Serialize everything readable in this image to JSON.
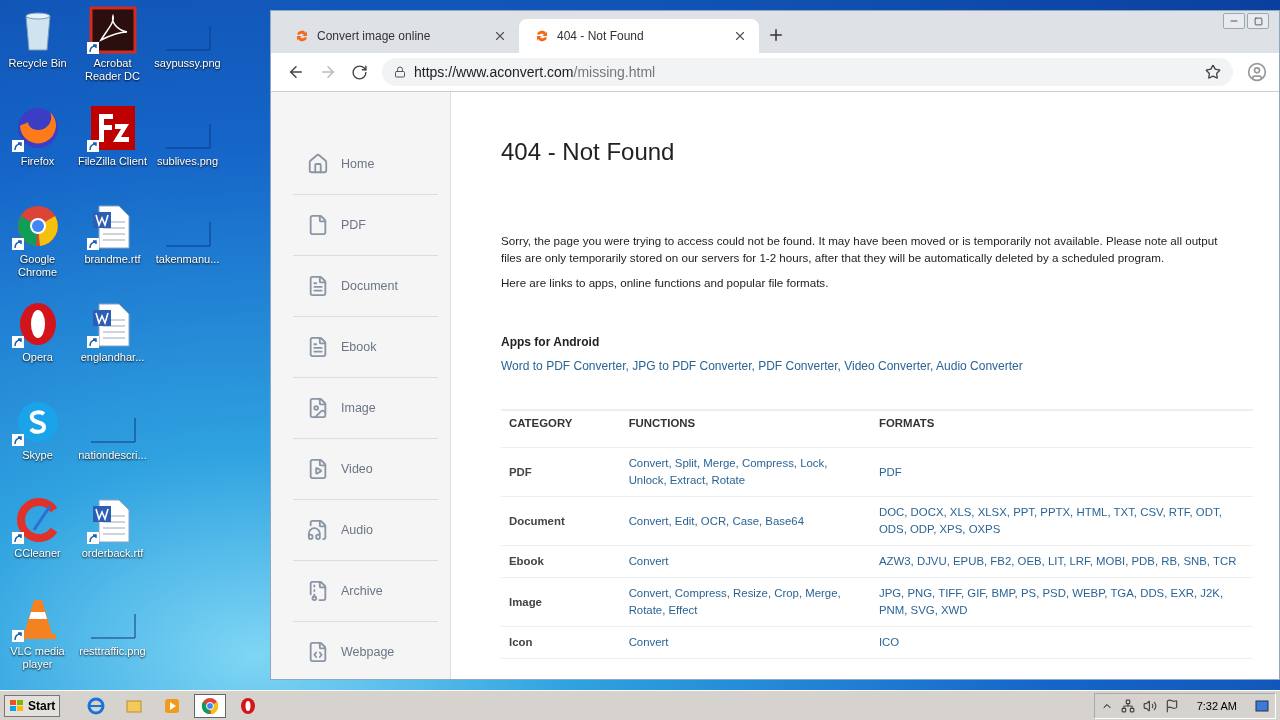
{
  "desktop": {
    "icons": [
      {
        "label": "Recycle Bin",
        "kind": "recycle"
      },
      {
        "label": "Firefox",
        "kind": "firefox"
      },
      {
        "label": "Google Chrome",
        "kind": "chrome"
      },
      {
        "label": "Opera",
        "kind": "opera"
      },
      {
        "label": "Skype",
        "kind": "skype"
      },
      {
        "label": "CCleaner",
        "kind": "ccleaner"
      },
      {
        "label": "VLC media player",
        "kind": "vlc"
      },
      {
        "label": "Acrobat Reader DC",
        "kind": "acrobat"
      },
      {
        "label": "FileZilla Client",
        "kind": "filezilla"
      },
      {
        "label": "brandme.rtf",
        "kind": "word"
      },
      {
        "label": "englandhar...",
        "kind": "word"
      },
      {
        "label": "nationdescri...",
        "kind": "blank"
      },
      {
        "label": "orderback.rtf",
        "kind": "word"
      },
      {
        "label": "resttraffic.png",
        "kind": "blank"
      },
      {
        "label": "saypussy.png",
        "kind": "blank"
      },
      {
        "label": "sublives.png",
        "kind": "blank"
      },
      {
        "label": "takenmanu...",
        "kind": "blank"
      }
    ]
  },
  "browser": {
    "tabs": [
      {
        "title": "Convert image online",
        "selected": false
      },
      {
        "title": "404 - Not Found",
        "selected": true
      }
    ],
    "address": {
      "host": "https://www.aconvert.com",
      "path": "/missing.html"
    }
  },
  "sidebar": {
    "items": [
      {
        "label": "Home",
        "kind": "home"
      },
      {
        "label": "PDF",
        "kind": "pdf"
      },
      {
        "label": "Document",
        "kind": "document"
      },
      {
        "label": "Ebook",
        "kind": "ebook"
      },
      {
        "label": "Image",
        "kind": "image"
      },
      {
        "label": "Video",
        "kind": "video"
      },
      {
        "label": "Audio",
        "kind": "audio"
      },
      {
        "label": "Archive",
        "kind": "archive"
      },
      {
        "label": "Webpage",
        "kind": "webpage"
      }
    ]
  },
  "page": {
    "heading": "404 - Not Found",
    "paragraphs": [
      "Sorry, the page you were trying to access could not be found. It may have been moved or is temporarily not available. Please note all output files are only temporarily stored on our servers for 1-2 hours, after that they will be automatically deleted by a scheduled program.",
      "Here are links to apps, online functions and popular file formats."
    ],
    "apps_heading": "Apps for Android",
    "app_links": "Word to PDF Converter, JPG to PDF Converter, PDF Converter, Video Converter, Audio Converter",
    "table": {
      "columns": [
        "CATEGORY",
        "FUNCTIONS",
        "FORMATS"
      ],
      "rows": [
        {
          "category": "PDF",
          "functions": "Convert, Split, Merge, Compress, Lock, Unlock, Extract, Rotate",
          "formats": "PDF"
        },
        {
          "category": "Document",
          "functions": "Convert, Edit, OCR, Case, Base64",
          "formats": "DOC, DOCX, XLS, XLSX, PPT, PPTX, HTML, TXT, CSV, RTF, ODT, ODS, ODP, XPS, OXPS"
        },
        {
          "category": "Ebook",
          "functions": "Convert",
          "formats": "AZW3, DJVU, EPUB, FB2, OEB, LIT, LRF, MOBI, PDB, RB, SNB, TCR"
        },
        {
          "category": "Image",
          "functions": "Convert, Compress, Resize, Crop, Merge, Rotate, Effect",
          "formats": "JPG, PNG, TIFF, GIF, BMP, PS, PSD, WEBP, TGA, DDS, EXR, J2K, PNM, SVG, XWD"
        },
        {
          "category": "Icon",
          "functions": "Convert",
          "formats": "ICO"
        }
      ]
    }
  },
  "taskbar": {
    "start": "Start",
    "apps": [
      {
        "kind": "ie",
        "selected": false
      },
      {
        "kind": "explorer",
        "selected": false
      },
      {
        "kind": "media",
        "selected": false
      },
      {
        "kind": "chrome",
        "selected": true
      },
      {
        "kind": "opera",
        "selected": false
      }
    ],
    "clock": "7:32 AM"
  }
}
